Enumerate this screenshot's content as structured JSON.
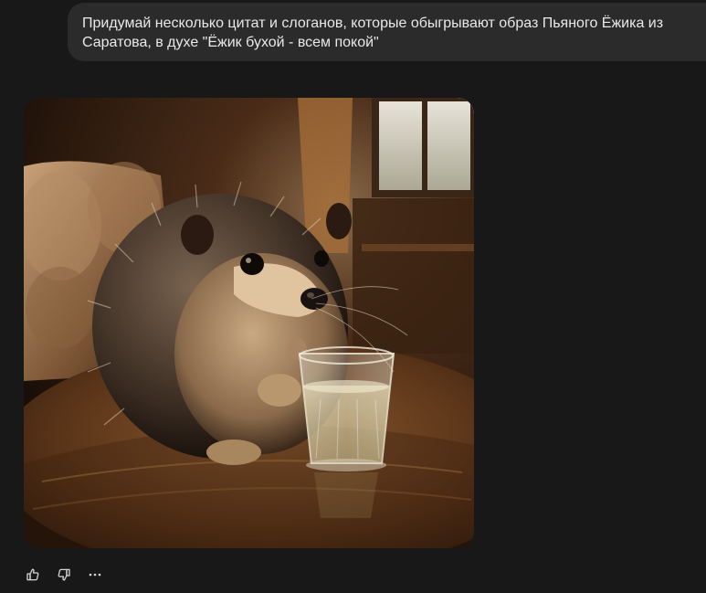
{
  "user_message": {
    "lines": [
      "Придумай несколько цитат и слоганов, которые обыгрывают образ Пьяного Ёжика из",
      "Саратова, в духе \"Ёжик бухой - всем покой\""
    ]
  },
  "generated_image": {
    "subject": "hedgehog sitting at a wooden pub table with a shot glass"
  },
  "actions": {
    "like_icon": "thumbs-up-icon",
    "dislike_icon": "thumbs-down-icon",
    "more_icon": "more-horizontal-icon"
  },
  "colors": {
    "background": "#181818",
    "bubble": "#2b2b2b",
    "text": "#e9e9e9",
    "icon": "#d6d6d6"
  }
}
